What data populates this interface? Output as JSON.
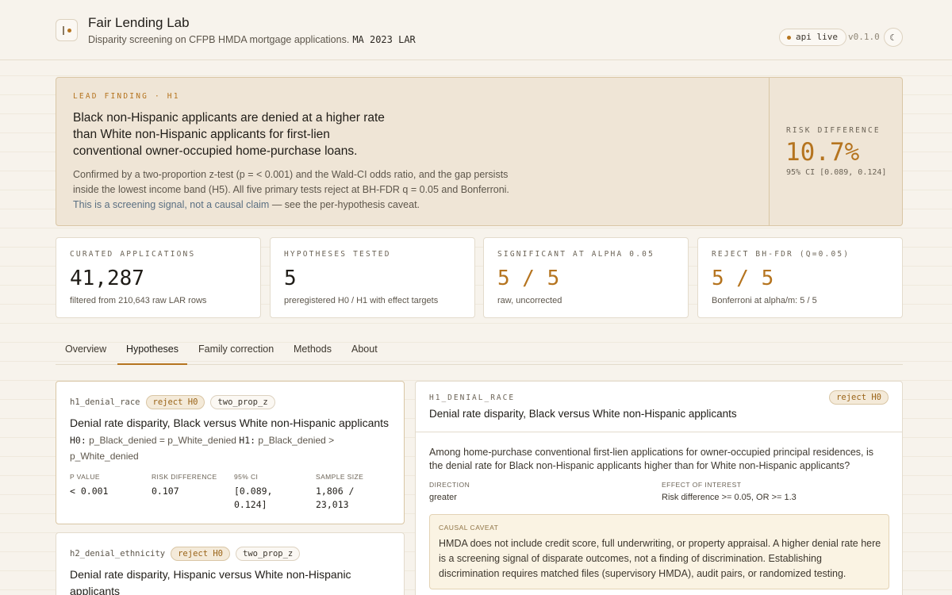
{
  "header": {
    "title": "Fair Lending Lab",
    "subtitle": "Disparity screening on CFPB HMDA mortgage applications.",
    "dataset": "MA 2023 LAR",
    "api_status": "api live",
    "version": "v0.1.0",
    "theme_icon": "moon-icon"
  },
  "lead": {
    "tag": "LEAD FINDING · H1",
    "headline": "Black non-Hispanic applicants are denied at a higher rate than White non-Hispanic applicants for first-lien conventional owner-occupied home-purchase loans.",
    "body_pre": "Confirmed by a two-proportion z-test (p = < 0.001) and the Wald-CI odds ratio, and the gap persists inside the lowest income band (H5). All five primary tests reject at BH-FDR q = 0.05 and Bonferroni. ",
    "body_link": "This is a screening signal, not a causal claim",
    "body_post": " — see the per-hypothesis caveat.",
    "risk_label": "RISK DIFFERENCE",
    "risk_value": "10.7%",
    "risk_ci": "95% CI [0.089, 0.124]"
  },
  "stats": [
    {
      "label": "CURATED APPLICATIONS",
      "value": "41,287",
      "sub": "filtered from 210,643 raw LAR rows"
    },
    {
      "label": "HYPOTHESES TESTED",
      "value": "5",
      "sub": "preregistered H0 / H1 with effect targets"
    },
    {
      "label": "SIGNIFICANT AT ALPHA 0.05",
      "value": "5 / 5",
      "sub": "raw, uncorrected"
    },
    {
      "label": "REJECT BH-FDR (Q=0.05)",
      "value": "5 / 5",
      "sub": "Bonferroni at alpha/m: 5 / 5"
    }
  ],
  "tabs": [
    "Overview",
    "Hypotheses",
    "Family correction",
    "Methods",
    "About"
  ],
  "active_tab": "Hypotheses",
  "hypotheses": [
    {
      "id": "h1_denial_race",
      "status": "reject H0",
      "method": "two_prop_z",
      "title": "Denial rate disparity, Black versus White non-Hispanic applicants",
      "h0_label": "H0:",
      "h0_text": "p_Black_denied = p_White_denied",
      "h1_label": "H1:",
      "h1_text": "p_Black_denied > p_White_denied",
      "metrics": [
        {
          "label": "P VALUE",
          "value": "< 0.001"
        },
        {
          "label": "RISK DIFFERENCE",
          "value": "0.107"
        },
        {
          "label": "95% CI",
          "value": "[0.089, 0.124]"
        },
        {
          "label": "SAMPLE SIZE",
          "value": "1,806 / 23,013"
        }
      ]
    },
    {
      "id": "h2_denial_ethnicity",
      "status": "reject H0",
      "method": "two_prop_z",
      "title": "Denial rate disparity, Hispanic versus White non-Hispanic applicants"
    }
  ],
  "detail": {
    "id": "H1_DENIAL_RACE",
    "title": "Denial rate disparity, Black versus White non-Hispanic applicants",
    "status": "reject H0",
    "question": "Among home-purchase conventional first-lien applications for owner-occupied principal residences, is the denial rate for Black non-Hispanic applicants higher than for White non-Hispanic applicants?",
    "direction_label": "DIRECTION",
    "direction_value": "greater",
    "effect_label": "EFFECT OF INTEREST",
    "effect_value": "Risk difference >= 0.05, OR >= 1.3",
    "caveat_label": "CAUSAL CAVEAT",
    "caveat_text": "HMDA does not include credit score, full underwriting, or property appraisal. A higher denial rate here is a screening signal of disparate outcomes, not a finding of discrimination. Establishing discrimination requires matched files (supervisory HMDA), audit pairs, or randomized testing."
  },
  "colors": {
    "accent": "#b5741f",
    "background": "#f7f3ec",
    "lead_background": "#efe5d6",
    "link": "#5a6f82"
  }
}
